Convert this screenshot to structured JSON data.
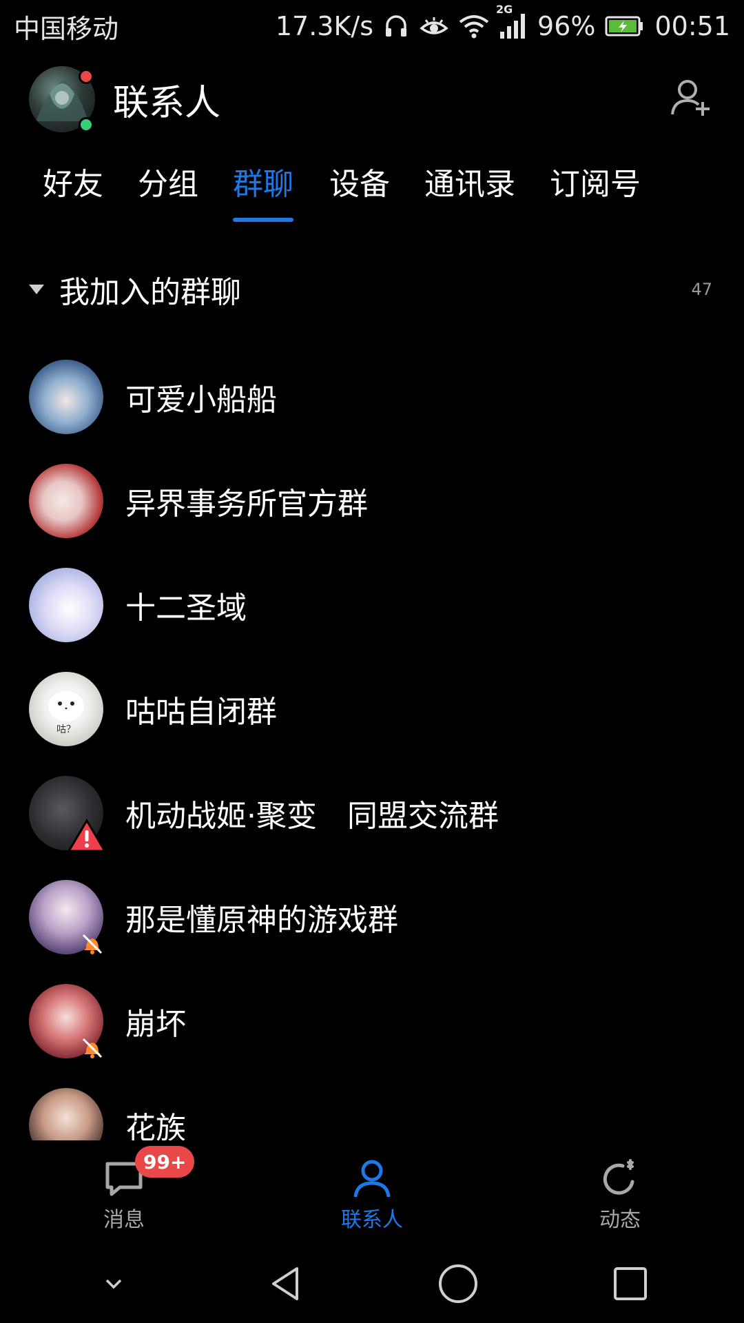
{
  "status_bar": {
    "carrier": "中国移动",
    "speed": "17.3K/s",
    "network_type": "2G",
    "battery": "96%",
    "time": "00:51",
    "icons": [
      "headphones-icon",
      "eye-icon",
      "wifi-icon",
      "signal-icon",
      "battery-charging-icon"
    ]
  },
  "header": {
    "title": "联系人",
    "add_icon": "add-contact-icon"
  },
  "tabs": [
    {
      "label": "好友",
      "active": false
    },
    {
      "label": "分组",
      "active": false
    },
    {
      "label": "群聊",
      "active": true
    },
    {
      "label": "设备",
      "active": false
    },
    {
      "label": "通讯录",
      "active": false
    },
    {
      "label": "订阅号",
      "active": false
    }
  ],
  "section": {
    "title": "我加入的群聊",
    "count": "47"
  },
  "groups": [
    {
      "name": "可爱小船船",
      "badge": ""
    },
    {
      "name": "异界事务所官方群",
      "badge": ""
    },
    {
      "name": "十二圣域",
      "badge": ""
    },
    {
      "name": "咕咕自闭群",
      "badge": "",
      "avatar_text": "咕？"
    },
    {
      "name": "机动战姬·聚变　同盟交流群",
      "badge": "warning"
    },
    {
      "name": "那是懂原神的游戏群",
      "badge": "muted"
    },
    {
      "name": "崩坏",
      "badge": "muted"
    },
    {
      "name": "花族",
      "badge": "muted"
    }
  ],
  "bottom_nav": [
    {
      "label": "消息",
      "icon": "chat-bubble-icon",
      "badge": "99+",
      "active": false
    },
    {
      "label": "联系人",
      "icon": "person-icon",
      "badge": "",
      "active": true
    },
    {
      "label": "动态",
      "icon": "refresh-star-icon",
      "badge": "",
      "active": false
    }
  ],
  "colors": {
    "accent": "#1e78e6",
    "badge_red": "#e84848",
    "background": "#000000"
  }
}
